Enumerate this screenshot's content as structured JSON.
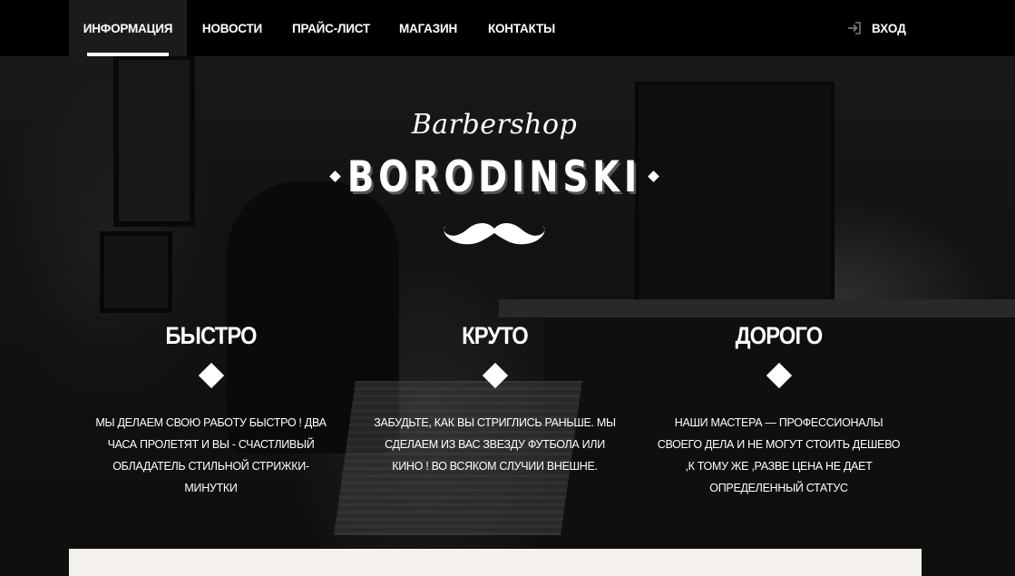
{
  "nav": {
    "items": [
      {
        "label": "ИНФОРМАЦИЯ",
        "active": true
      },
      {
        "label": "НОВОСТИ",
        "active": false
      },
      {
        "label": "ПРАЙС-ЛИСТ",
        "active": false
      },
      {
        "label": "МАГАЗИН",
        "active": false
      },
      {
        "label": "КОНТАКТЫ",
        "active": false
      }
    ],
    "login_label": "ВХОД",
    "login_icon": "sign-in-icon"
  },
  "logo": {
    "script": "Barbershop",
    "title": "BORODINSKI",
    "emblem": "mustache-icon"
  },
  "features": [
    {
      "title": "БЫСТРО",
      "text": "МЫ ДЕЛАЕМ СВОЮ РАБОТУ БЫСТРО ! ДВА ЧАСА ПРОЛЕТЯТ И ВЫ - СЧАСТЛИВЫЙ ОБЛАДАТЕЛЬ СТИЛЬНОЙ СТРИЖКИ-МИНУТКИ"
    },
    {
      "title": "КРУТО",
      "text": "ЗАБУДЬТЕ, КАК ВЫ СТРИГЛИСЬ РАНЬШЕ. МЫ СДЕЛАЕМ ИЗ ВАС ЗВЕЗДУ ФУТБОЛА ИЛИ КИНО ! ВО ВСЯКОМ СЛУЧИИ ВНЕШНЕ."
    },
    {
      "title": "ДОРОГО",
      "text": "НАШИ МАСТЕРА — ПРОФЕССИОНАЛЫ СВОЕГО ДЕЛА И НЕ МОГУТ СТОИТЬ ДЕШЕВО ,К ТОМУ ЖЕ ,РАЗВЕ ЦЕНА НЕ ДАЕТ ОПРЕДЕЛЕННЫЙ СТАТУС"
    }
  ],
  "colors": {
    "nav_bg": "#000000",
    "active_nav_bg": "#1b1b1b",
    "text": "#ffffff",
    "panel": "#f4f1ec"
  }
}
